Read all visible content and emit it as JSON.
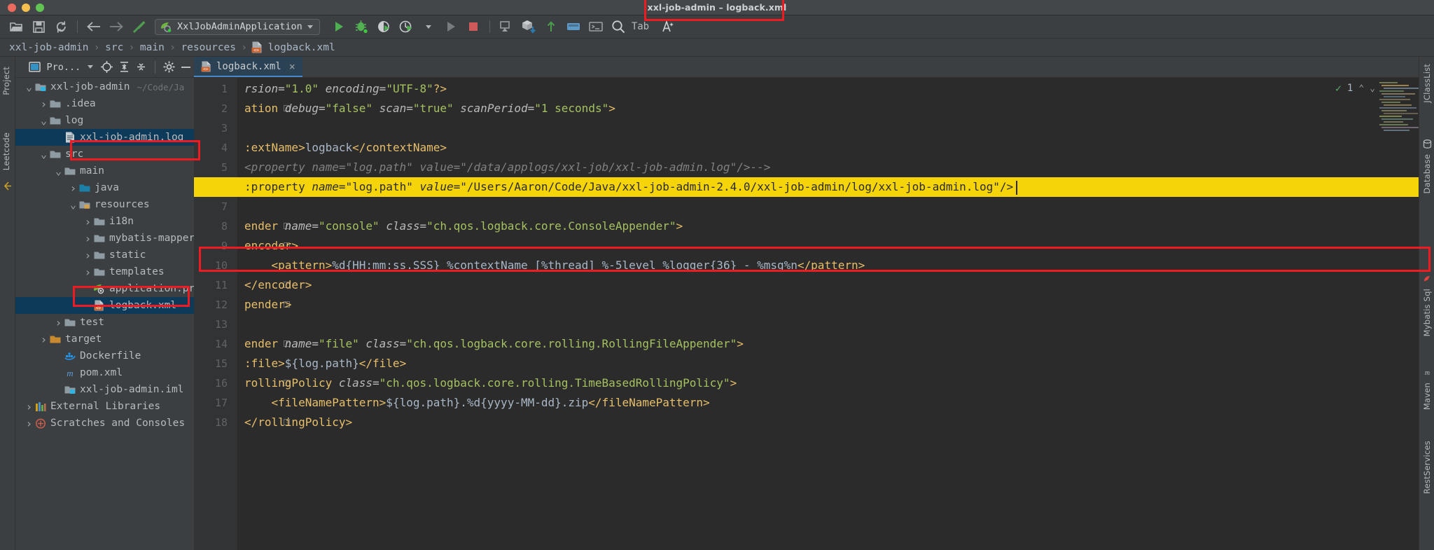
{
  "window": {
    "title": "xxl-job-admin – logback.xml",
    "traffic_lights": [
      "close",
      "minimize",
      "maximize"
    ]
  },
  "toolbar": {
    "icons_left": [
      "open-folder-icon",
      "save-icon",
      "sync-icon"
    ],
    "nav_icons": [
      "back-arrow-icon",
      "forward-arrow-icon",
      "build-hammer-icon"
    ],
    "run_config": {
      "label": "XxlJobAdminApplication",
      "icon": "spring-boot-icon"
    },
    "run_icons": [
      "run-icon",
      "debug-icon",
      "run-coverage-icon",
      "profiler-icon",
      "profiler-dropdown-icon",
      "rerun-icon",
      "stop-icon"
    ],
    "right_icons": [
      "device-manager-icon",
      "package-install-icon",
      "git-update-icon",
      "git-commit-icon",
      "terminal-icon",
      "search-everywhere-icon",
      "ai-assistant-icon"
    ],
    "search_label": "Tab"
  },
  "breadcrumb": {
    "items": [
      {
        "label": "xxl-job-admin",
        "icon": null
      },
      {
        "label": "src",
        "icon": null
      },
      {
        "label": "main",
        "icon": null
      },
      {
        "label": "resources",
        "icon": null
      },
      {
        "label": "logback.xml",
        "icon": "xml-file-icon"
      }
    ],
    "separator": "›"
  },
  "left_tool_tabs": [
    {
      "label": "Project",
      "icon": "project-icon"
    },
    {
      "label": "Leetcode",
      "icon": "leetcode-icon"
    }
  ],
  "project_panel": {
    "title": "Pro...",
    "header_icons": [
      "project-view-icon",
      "dropdown-caret-icon",
      "locate-target-icon",
      "expand-all-icon",
      "collapse-all-icon",
      "settings-gear-icon",
      "hide-panel-icon"
    ],
    "tree": [
      {
        "depth": 0,
        "arrow": "down",
        "icon": "module-folder-icon",
        "label": "xxl-job-admin",
        "path": "~/Code/Ja",
        "selected": false,
        "highlight": false
      },
      {
        "depth": 1,
        "arrow": "right",
        "icon": "folder-icon",
        "label": ".idea",
        "selected": false,
        "highlight": false
      },
      {
        "depth": 1,
        "arrow": "down",
        "icon": "folder-icon",
        "label": "log",
        "selected": false,
        "highlight": false
      },
      {
        "depth": 2,
        "arrow": "none",
        "icon": "log-file-icon",
        "label": "xxl-job-admin.log",
        "selected": true,
        "highlight": true
      },
      {
        "depth": 1,
        "arrow": "down",
        "icon": "folder-icon",
        "label": "src",
        "selected": false,
        "highlight": false
      },
      {
        "depth": 2,
        "arrow": "down",
        "icon": "folder-icon",
        "label": "main",
        "selected": false,
        "highlight": false
      },
      {
        "depth": 3,
        "arrow": "right",
        "icon": "source-folder-icon",
        "label": "java",
        "selected": false,
        "highlight": false
      },
      {
        "depth": 3,
        "arrow": "down",
        "icon": "resource-folder-icon",
        "label": "resources",
        "selected": false,
        "highlight": false
      },
      {
        "depth": 4,
        "arrow": "right",
        "icon": "folder-icon",
        "label": "i18n",
        "selected": false,
        "highlight": false
      },
      {
        "depth": 4,
        "arrow": "right",
        "icon": "folder-icon",
        "label": "mybatis-mapper",
        "selected": false,
        "highlight": false
      },
      {
        "depth": 4,
        "arrow": "right",
        "icon": "folder-icon",
        "label": "static",
        "selected": false,
        "highlight": false
      },
      {
        "depth": 4,
        "arrow": "right",
        "icon": "folder-icon",
        "label": "templates",
        "selected": false,
        "highlight": false
      },
      {
        "depth": 4,
        "arrow": "none",
        "icon": "spring-properties-icon",
        "label": "application.pr",
        "selected": false,
        "highlight": false
      },
      {
        "depth": 4,
        "arrow": "none",
        "icon": "xml-file-icon",
        "label": "logback.xml",
        "selected": true,
        "highlight": true
      },
      {
        "depth": 2,
        "arrow": "right",
        "icon": "folder-icon",
        "label": "test",
        "selected": false,
        "highlight": false
      },
      {
        "depth": 1,
        "arrow": "right",
        "icon": "target-folder-icon",
        "label": "target",
        "selected": false,
        "highlight": false
      },
      {
        "depth": 2,
        "arrow": "none",
        "icon": "docker-file-icon",
        "label": "Dockerfile",
        "selected": false,
        "highlight": false
      },
      {
        "depth": 2,
        "arrow": "none",
        "icon": "maven-pom-icon",
        "label": "pom.xml",
        "selected": false,
        "highlight": false
      },
      {
        "depth": 2,
        "arrow": "none",
        "icon": "iml-file-icon",
        "label": "xxl-job-admin.iml",
        "selected": false,
        "highlight": false
      },
      {
        "depth": 0,
        "arrow": "right",
        "icon": "libraries-icon",
        "label": "External Libraries",
        "selected": false,
        "highlight": false
      },
      {
        "depth": 0,
        "arrow": "right",
        "icon": "scratches-icon",
        "label": "Scratches and Consoles",
        "selected": false,
        "highlight": false
      }
    ]
  },
  "editor": {
    "tab": {
      "label": "logback.xml",
      "icon": "xml-file-icon",
      "close": "×",
      "highlighted": true
    },
    "inspection": {
      "count": "1",
      "status_icon": "inspections-ok-icon",
      "up": "⌃",
      "down": "⌄"
    },
    "current_line": 6,
    "lines": [
      {
        "n": 1,
        "fold": false,
        "highlight": false,
        "tokens": [
          {
            "c": "t-attr",
            "t": "rsion="
          },
          {
            "c": "t-val",
            "t": "\"1.0\""
          },
          {
            "c": "t-txt",
            "t": " "
          },
          {
            "c": "t-attr",
            "t": "encoding="
          },
          {
            "c": "t-val",
            "t": "\"UTF-8\""
          },
          {
            "c": "t-tag",
            "t": "?>"
          }
        ]
      },
      {
        "n": 2,
        "fold": true,
        "highlight": false,
        "tokens": [
          {
            "c": "t-tag",
            "t": "ation "
          },
          {
            "c": "t-attr",
            "t": "debug="
          },
          {
            "c": "t-val",
            "t": "\"false\""
          },
          {
            "c": "t-txt",
            "t": " "
          },
          {
            "c": "t-attr",
            "t": "scan="
          },
          {
            "c": "t-val",
            "t": "\"true\""
          },
          {
            "c": "t-txt",
            "t": " "
          },
          {
            "c": "t-attr",
            "t": "scanPeriod="
          },
          {
            "c": "t-val",
            "t": "\"1 seconds\""
          },
          {
            "c": "t-tag",
            "t": ">"
          }
        ]
      },
      {
        "n": 3,
        "fold": false,
        "highlight": false,
        "tokens": []
      },
      {
        "n": 4,
        "fold": false,
        "highlight": false,
        "tokens": [
          {
            "c": "t-tag",
            "t": ":extName>"
          },
          {
            "c": "t-txt",
            "t": "logback"
          },
          {
            "c": "t-tag",
            "t": "</contextName>"
          }
        ]
      },
      {
        "n": 5,
        "fold": false,
        "highlight": false,
        "tokens": [
          {
            "c": "t-com",
            "t": "<property name=\"log.path\" value=\"/data/applogs/xxl-job/xxl-job-admin.log\"/>-->"
          }
        ]
      },
      {
        "n": 6,
        "fold": false,
        "highlight": true,
        "tokens": [
          {
            "c": "t-tag",
            "t": ":property "
          },
          {
            "c": "t-attr",
            "t": "name="
          },
          {
            "c": "t-val",
            "t": "\"log.path\""
          },
          {
            "c": "t-txt",
            "t": " "
          },
          {
            "c": "t-attr",
            "t": "value="
          },
          {
            "c": "t-val",
            "t": "\"/Users/Aaron/Code/Java/xxl-job-admin-2.4.0/xxl-job-admin/log/xxl-job-admin.log\""
          },
          {
            "c": "t-tag",
            "t": "/>"
          }
        ]
      },
      {
        "n": 7,
        "fold": false,
        "highlight": false,
        "tokens": []
      },
      {
        "n": 8,
        "fold": true,
        "highlight": false,
        "tokens": [
          {
            "c": "t-tag",
            "t": "ender "
          },
          {
            "c": "t-attr",
            "t": "name="
          },
          {
            "c": "t-val",
            "t": "\"console\""
          },
          {
            "c": "t-txt",
            "t": " "
          },
          {
            "c": "t-attr",
            "t": "class="
          },
          {
            "c": "t-val",
            "t": "\"ch.qos.logback.core.ConsoleAppender\""
          },
          {
            "c": "t-tag",
            "t": ">"
          }
        ]
      },
      {
        "n": 9,
        "fold": true,
        "highlight": false,
        "tokens": [
          {
            "c": "t-tag",
            "t": "encoder>"
          }
        ]
      },
      {
        "n": 10,
        "fold": false,
        "highlight": false,
        "tokens": [
          {
            "c": "t-txt",
            "t": "    "
          },
          {
            "c": "t-tag",
            "t": "<pattern>"
          },
          {
            "c": "t-txt",
            "t": "%d{HH:mm:ss.SSS} %contextName [%thread] %-5level %logger{36} - %msg%n"
          },
          {
            "c": "t-tag",
            "t": "</pattern>"
          }
        ]
      },
      {
        "n": 11,
        "fold": true,
        "highlight": false,
        "tokens": [
          {
            "c": "t-tag",
            "t": "</encoder>"
          }
        ]
      },
      {
        "n": 12,
        "fold": true,
        "highlight": false,
        "tokens": [
          {
            "c": "t-tag",
            "t": "pender>"
          }
        ]
      },
      {
        "n": 13,
        "fold": false,
        "highlight": false,
        "tokens": []
      },
      {
        "n": 14,
        "fold": true,
        "highlight": false,
        "tokens": [
          {
            "c": "t-tag",
            "t": "ender "
          },
          {
            "c": "t-attr",
            "t": "name="
          },
          {
            "c": "t-val",
            "t": "\"file\""
          },
          {
            "c": "t-txt",
            "t": " "
          },
          {
            "c": "t-attr",
            "t": "class="
          },
          {
            "c": "t-val",
            "t": "\"ch.qos.logback.core.rolling.RollingFileAppender\""
          },
          {
            "c": "t-tag",
            "t": ">"
          }
        ]
      },
      {
        "n": 15,
        "fold": false,
        "highlight": false,
        "tokens": [
          {
            "c": "t-tag",
            "t": ":file>"
          },
          {
            "c": "t-txt",
            "t": "${log.path}"
          },
          {
            "c": "t-tag",
            "t": "</file>"
          }
        ]
      },
      {
        "n": 16,
        "fold": true,
        "highlight": false,
        "tokens": [
          {
            "c": "t-tag",
            "t": "rollingPolicy "
          },
          {
            "c": "t-attr",
            "t": "class="
          },
          {
            "c": "t-val",
            "t": "\"ch.qos.logback.core.rolling.TimeBasedRollingPolicy\""
          },
          {
            "c": "t-tag",
            "t": ">"
          }
        ]
      },
      {
        "n": 17,
        "fold": false,
        "highlight": false,
        "tokens": [
          {
            "c": "t-txt",
            "t": "    "
          },
          {
            "c": "t-tag",
            "t": "<fileNamePattern>"
          },
          {
            "c": "t-txt",
            "t": "${log.path}.%d{yyyy-MM-dd}.zip"
          },
          {
            "c": "t-tag",
            "t": "</fileNamePattern>"
          }
        ]
      },
      {
        "n": 18,
        "fold": true,
        "highlight": false,
        "tokens": [
          {
            "c": "t-tag",
            "t": "</rollingPolicy>"
          }
        ]
      }
    ]
  },
  "right_tool_tabs": [
    {
      "label": "JClassList",
      "icon": "jclasslist-icon"
    },
    {
      "label": "Database",
      "icon": "database-icon"
    },
    {
      "label": "Mybatis Sql",
      "icon": "mybatis-icon"
    },
    {
      "label": "Maven",
      "icon": "maven-icon"
    },
    {
      "label": "RestServices",
      "icon": "rest-icon"
    }
  ],
  "colors": {
    "accent_red": "#ee1b22",
    "highlight_yellow": "#f5d40a",
    "selection_blue": "#0d3a58",
    "editor_bg": "#2b2b2b",
    "panel_bg": "#3c3f41"
  }
}
